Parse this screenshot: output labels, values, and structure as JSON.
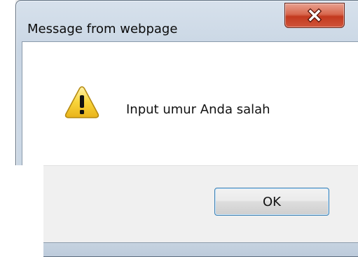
{
  "dialog": {
    "title": "Message from webpage",
    "message": "Input umur Anda salah",
    "ok_label": "OK",
    "icon": "warning-icon",
    "close_icon": "close-icon"
  },
  "colors": {
    "frame": "#cdd9e6",
    "close_button": "#c3391f",
    "button_panel": "#f0f0f0",
    "ok_border": "#3c7fb1",
    "warning_fill": "#f6d23a"
  }
}
